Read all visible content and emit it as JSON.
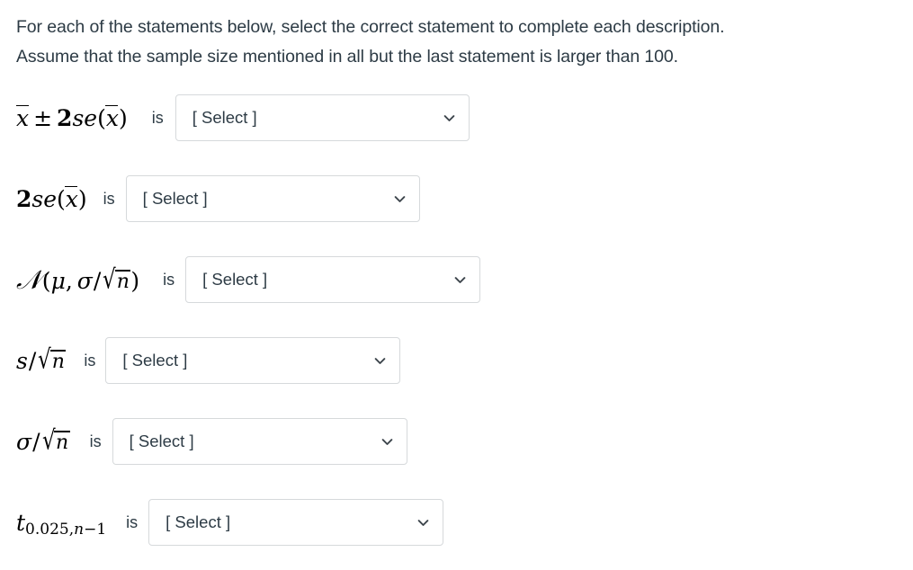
{
  "intro": {
    "line1": "For each of the statements below, select the correct statement to complete each description.",
    "line2": "Assume that the sample size mentioned in all but the last statement is larger than 100."
  },
  "labels": {
    "is": "is",
    "select_placeholder": "[ Select ]"
  },
  "colors": {
    "text": "#2d3b45",
    "math": "#000000",
    "border": "#d6d9db",
    "background": "#ffffff"
  },
  "statements": [
    {
      "id": "xbar-plus-minus-2se",
      "expression": "x̄ ± 2se(x̄)",
      "is": "is",
      "select": {
        "value": "[ Select ]",
        "placeholder": "[ Select ]",
        "icon": "chevron-down-icon"
      }
    },
    {
      "id": "2se-xbar",
      "expression": "2se(x̄)",
      "is": "is",
      "select": {
        "value": "[ Select ]",
        "placeholder": "[ Select ]",
        "icon": "chevron-down-icon"
      }
    },
    {
      "id": "normal-mu-sigma-over-sqrt-n",
      "expression": "N(μ, σ/√n)",
      "is": "is",
      "select": {
        "value": "[ Select ]",
        "placeholder": "[ Select ]",
        "icon": "chevron-down-icon"
      }
    },
    {
      "id": "s-over-sqrt-n",
      "expression": "s/√n",
      "is": "is",
      "select": {
        "value": "[ Select ]",
        "placeholder": "[ Select ]",
        "icon": "chevron-down-icon"
      }
    },
    {
      "id": "sigma-over-sqrt-n",
      "expression": "σ/√n",
      "is": "is",
      "select": {
        "value": "[ Select ]",
        "placeholder": "[ Select ]",
        "icon": "chevron-down-icon"
      }
    },
    {
      "id": "t-0025-n-minus-1",
      "expression": "t_{0.025,n−1}",
      "is": "is",
      "select": {
        "value": "[ Select ]",
        "placeholder": "[ Select ]",
        "icon": "chevron-down-icon"
      }
    }
  ]
}
